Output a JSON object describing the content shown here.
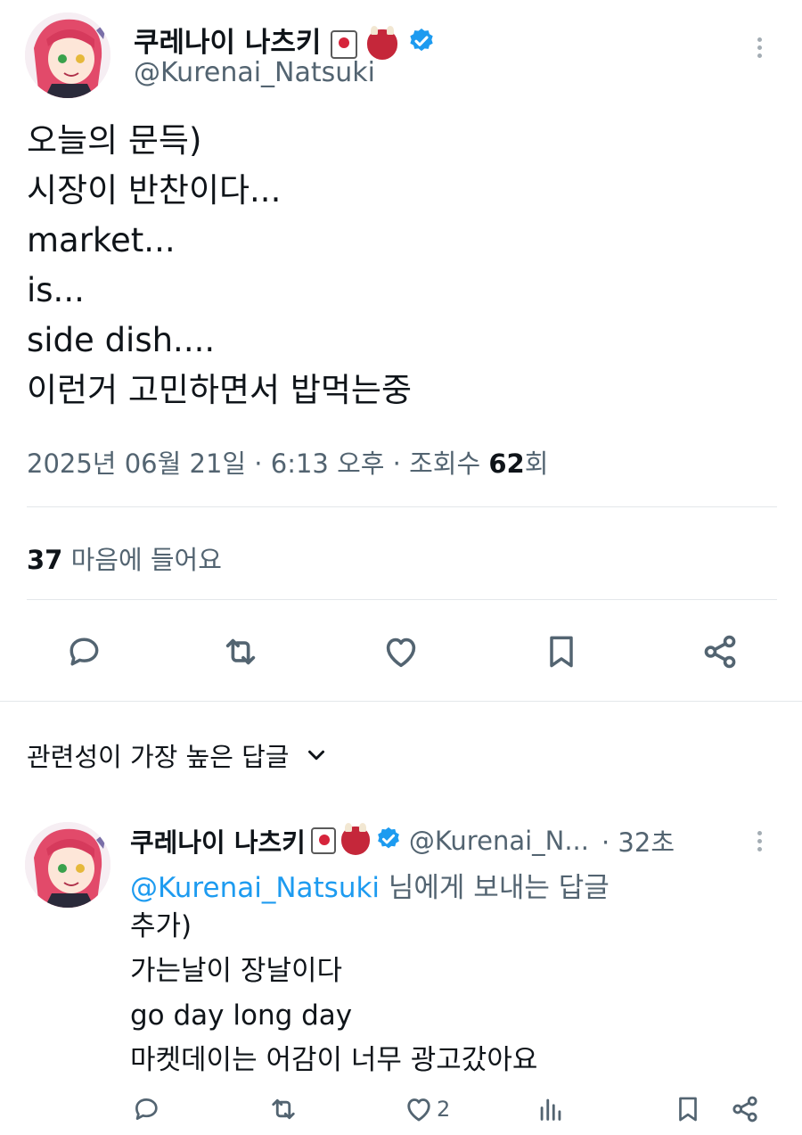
{
  "post": {
    "author_name": "쿠레나이 나츠키",
    "author_handle": "@Kurenai_Natsuki",
    "text_lines": [
      "오늘의 문득)",
      "시장이 반찬이다...",
      "market...",
      "is...",
      "side dish....",
      "이런거 고민하면서 밥먹는중"
    ],
    "meta": {
      "date": "2025년 06월 21일",
      "sep1": " · ",
      "time": "6:13 오후",
      "sep2": " · ",
      "views_label": "조회수 ",
      "views_count": "62",
      "views_suffix": "회"
    },
    "likes": {
      "count": "37",
      "label": " 마음에 들어요"
    }
  },
  "sort": {
    "label": "관련성이 가장 높은 답글"
  },
  "reply": {
    "author_name": "쿠레나이 나츠키",
    "author_handle": "@Kurenai_N...",
    "age": "· 32초",
    "replying_to_handle": "@Kurenai_Natsuki",
    "replying_to_suffix": " 님에게 보내는 답글",
    "text_lines": [
      "추가)",
      "가는날이 장날이다",
      "go day long day",
      "마켓데이는 어감이 너무 광고갔아요"
    ],
    "like_count": "2"
  },
  "colors": {
    "text": "#0f1419",
    "secondary": "#536471",
    "accent": "#1d9bf0",
    "divider": "#e3e7ea"
  },
  "icons": [
    "reply-icon",
    "retweet-icon",
    "like-icon",
    "bookmark-icon",
    "share-icon",
    "views-icon",
    "verified-badge-icon",
    "more-icon",
    "chevron-down-icon"
  ]
}
